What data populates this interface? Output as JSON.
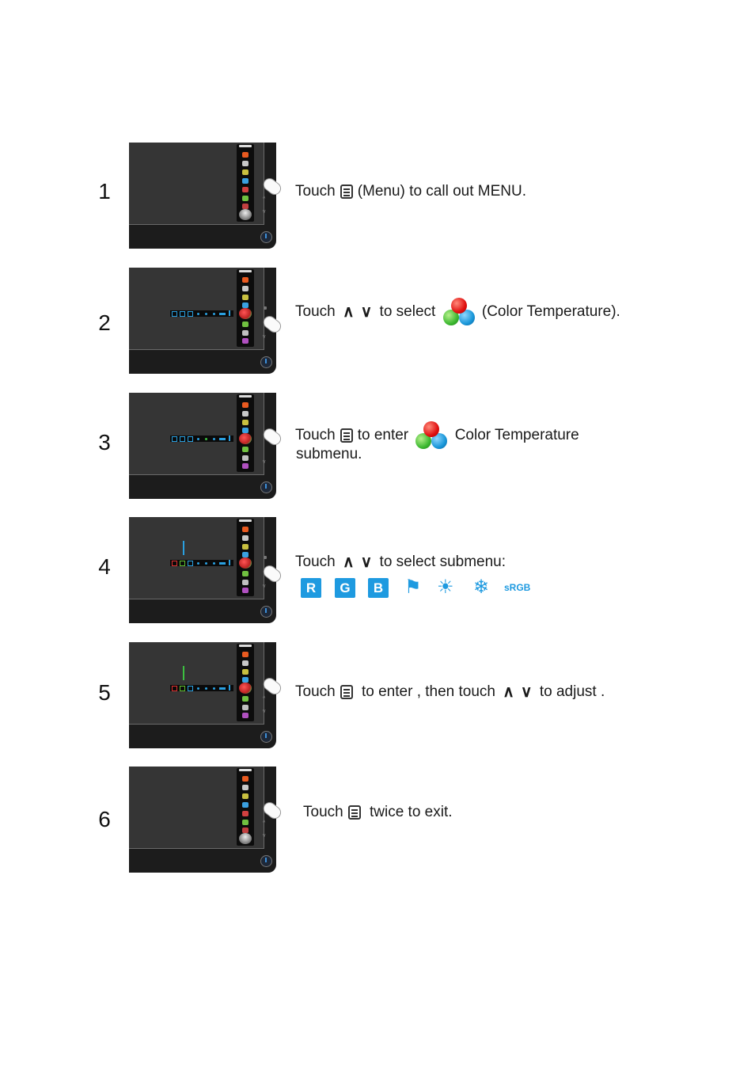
{
  "steps": [
    {
      "number": "1",
      "parts": [
        "Touch",
        "(Menu) to  call out MENU."
      ],
      "screen_state": "menu-open"
    },
    {
      "number": "2",
      "parts": [
        "Touch",
        "to select",
        "(Color  Temperature)."
      ],
      "screen_state": "color-temp-highlighted"
    },
    {
      "number": "3",
      "parts": [
        "Touch",
        "to enter",
        "Color  Temperature",
        "submenu."
      ],
      "screen_state": "color-temp-submenu"
    },
    {
      "number": "4",
      "parts": [
        "Touch",
        "to select submenu:"
      ],
      "screen_state": "submenu-select"
    },
    {
      "number": "5",
      "parts": [
        "Touch",
        "to enter ,  then touch",
        "to  adjust ."
      ],
      "screen_state": "adjust"
    },
    {
      "number": "6",
      "parts": [
        "Touch",
        "twice to exit."
      ],
      "screen_state": "menu-open"
    }
  ],
  "icons": {
    "menu": "menu-button-icon",
    "up": "∧",
    "down": "∨",
    "color_temperature": "color-temperature-icon"
  },
  "submenu_options": [
    {
      "name": "R",
      "type": "badge"
    },
    {
      "name": "G",
      "type": "badge"
    },
    {
      "name": "B",
      "type": "badge"
    },
    {
      "name": "user-flag",
      "glyph": "⚑"
    },
    {
      "name": "warm-sun",
      "glyph": "☀"
    },
    {
      "name": "cool-snowflake",
      "glyph": "❄"
    },
    {
      "name": "sRGB",
      "type": "text"
    }
  ],
  "colors": {
    "accent_blue": "#1e9ae0",
    "bezel": "#1c1c1c",
    "screen": "#353535"
  }
}
